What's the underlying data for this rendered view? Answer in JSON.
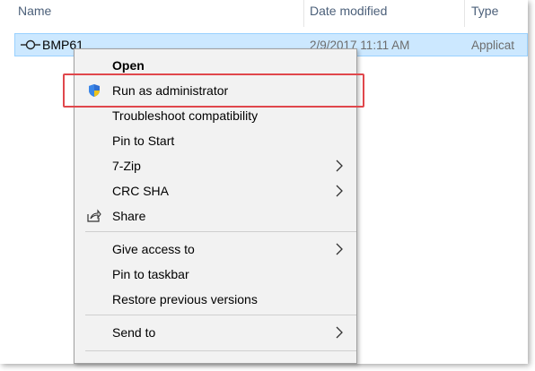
{
  "columns": {
    "name": "Name",
    "date_modified": "Date modified",
    "type": "Type"
  },
  "file": {
    "name": "BMP61",
    "date": "2/9/2017 11:11 AM",
    "type": "Applicat"
  },
  "menu": {
    "open": "Open",
    "run_as_admin": "Run as administrator",
    "troubleshoot": "Troubleshoot compatibility",
    "pin_start": "Pin to Start",
    "seven_zip": "7-Zip",
    "crc_sha": "CRC SHA",
    "share": "Share",
    "give_access": "Give access to",
    "pin_taskbar": "Pin to taskbar",
    "restore": "Restore previous versions",
    "send_to": "Send to"
  },
  "colors": {
    "selection": "#cce8ff",
    "highlight_border": "#e0474c",
    "header_text": "#4c607a"
  },
  "icons": {
    "file": "executable-icon",
    "run_as_admin": "uac-shield-icon",
    "share": "share-icon",
    "submenu": "chevron-right-icon"
  }
}
